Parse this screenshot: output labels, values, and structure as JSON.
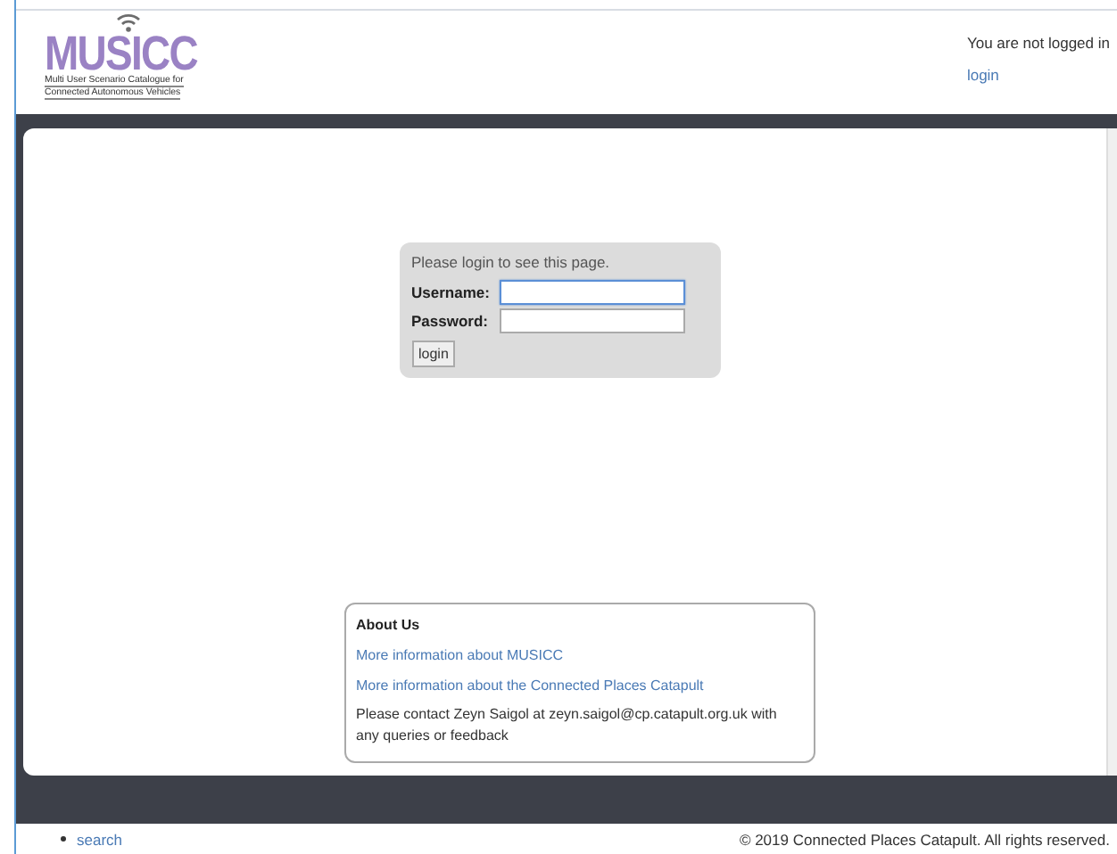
{
  "header": {
    "logo": {
      "title": "MUSICC",
      "subtitle_lines": [
        "Multi User Scenario Catalogue for",
        "Connected Autonomous Vehicles"
      ]
    },
    "status": "You are not logged in",
    "login_link": "login"
  },
  "login_box": {
    "message": "Please login to see this page.",
    "fields": [
      {
        "label": "Username:",
        "focused": true
      },
      {
        "label": "Password:",
        "focused": false
      }
    ],
    "button": "login"
  },
  "about": {
    "title": "About Us",
    "links": [
      "More information about MUSICC",
      "More information about the Connected Places Catapult"
    ],
    "contact": "Please contact Zeyn Saigol at zeyn.saigol@cp.catapult.org.uk with any queries or feedback"
  },
  "footer": {
    "links": [
      "search"
    ],
    "copyright": "© 2019 Connected Places Catapult. All rights reserved."
  }
}
